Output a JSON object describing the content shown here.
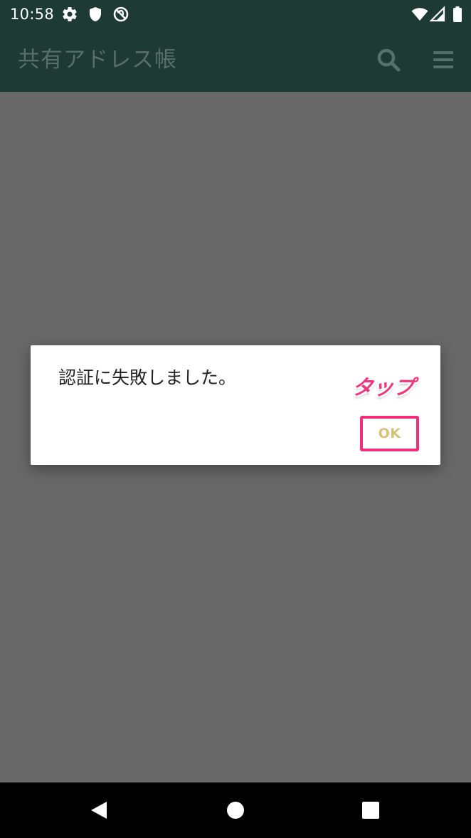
{
  "status_bar": {
    "time": "10:58",
    "left_icons": [
      "settings-gear-icon",
      "shield-icon",
      "do-not-disturb-icon"
    ],
    "right_icons": [
      "wifi-icon",
      "cellular-signal-icon",
      "battery-icon"
    ]
  },
  "app_bar": {
    "title": "共有アドレス帳",
    "actions": [
      "search-icon",
      "menu-icon"
    ]
  },
  "dialog": {
    "message": "認証に失敗しました。",
    "ok_label": "OK",
    "annotation": "タップ"
  },
  "nav_bar": {
    "buttons": [
      "back-icon",
      "home-icon",
      "recents-icon"
    ]
  },
  "colors": {
    "app_bar_bg": "#1e3a35",
    "scrim": "#686868",
    "dialog_bg": "#ffffff",
    "ok_text": "#d6c07a",
    "highlight": "#f02e7a"
  }
}
